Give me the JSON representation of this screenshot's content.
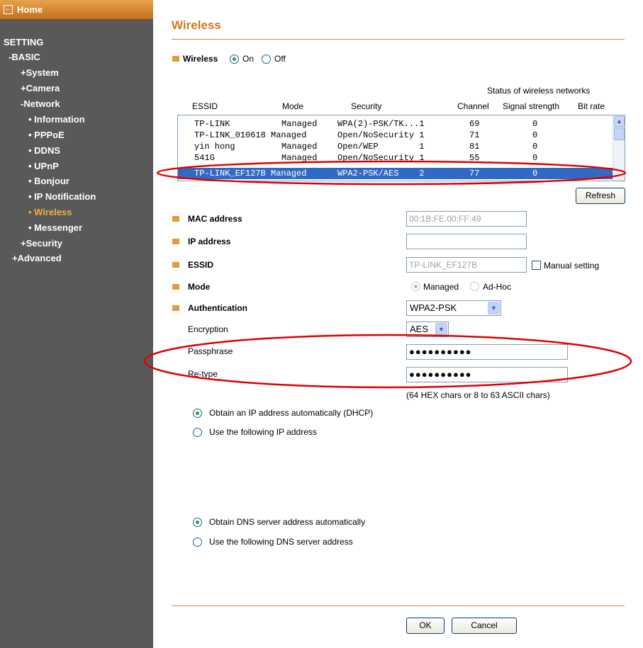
{
  "sidebar": {
    "home": "Home",
    "setting": "SETTING",
    "basic": "-BASIC",
    "system": "+System",
    "camera": "+Camera",
    "network": "-Network",
    "information": "• Information",
    "pppoe": "• PPPoE",
    "ddns": "• DDNS",
    "upnp": "• UPnP",
    "bonjour": "• Bonjour",
    "ip_notification": "• IP Notification",
    "wireless": "• Wireless",
    "messenger": "• Messenger",
    "security": "+Security",
    "advanced": "+Advanced",
    "active_color": "#f0b040"
  },
  "main": {
    "title": "Wireless",
    "wireless_label": "Wireless",
    "on_label": "On",
    "off_label": "Off",
    "status_caption": "Status of wireless networks",
    "columns": {
      "essid": "ESSID",
      "mode": "Mode",
      "security": "Security",
      "channel": "Channel",
      "signal": "Signal strength",
      "bitrate": "Bit rate"
    },
    "networks": [
      {
        "essid": "TP-LINK",
        "mode": "Managed",
        "security": "WPA(2)-PSK/TK...1",
        "channel": "69",
        "signal": "0",
        "selected": false
      },
      {
        "essid": "TP-LINK_010618",
        "mode": "Managed",
        "security": "Open/NoSecurity 1",
        "channel": "71",
        "signal": "0",
        "selected": false
      },
      {
        "essid": "yin hong",
        "mode": "Managed",
        "security": "Open/WEP        1",
        "channel": "81",
        "signal": "0",
        "selected": false
      },
      {
        "essid": "541G",
        "mode": "Managed",
        "security": "Open/NoSecurity 1",
        "channel": "55",
        "signal": "0",
        "selected": false
      },
      {
        "essid": "TP-LINK_EF127B",
        "mode": "Managed",
        "security": "WPA2-PSK/AES    2",
        "channel": "77",
        "signal": "0",
        "selected": true
      }
    ],
    "refresh_label": "Refresh",
    "mac_label": "MAC address",
    "mac_value": "00:1B:FE:00:FF:49",
    "ip_label": "IP address",
    "ip_value": "",
    "essid_label": "ESSID",
    "essid_value": "TP-LINK_EF127B",
    "manual_label": "Manual setting",
    "mode_label": "Mode",
    "managed_label": "Managed",
    "adhoc_label": "Ad-Hoc",
    "auth_label": "Authentication",
    "auth_value": "WPA2-PSK",
    "enc_label": "Encryption",
    "enc_value": "AES",
    "pass_label": "Passphrase",
    "pass_value": "●●●●●●●●●●",
    "retype_label": "Re-type",
    "retype_value": "●●●●●●●●●●",
    "hint": "(64 HEX chars or 8 to 63 ASCII chars)",
    "dhcp_label": "Obtain an IP address automatically (DHCP)",
    "static_label": "Use the following IP address",
    "dns_auto_label": "Obtain DNS server address automatically",
    "dns_manual_label": "Use the following DNS server address",
    "ok_label": "OK",
    "cancel_label": "Cancel",
    "accent_color": "#cc7a1e",
    "highlight_color": "#e00000"
  }
}
